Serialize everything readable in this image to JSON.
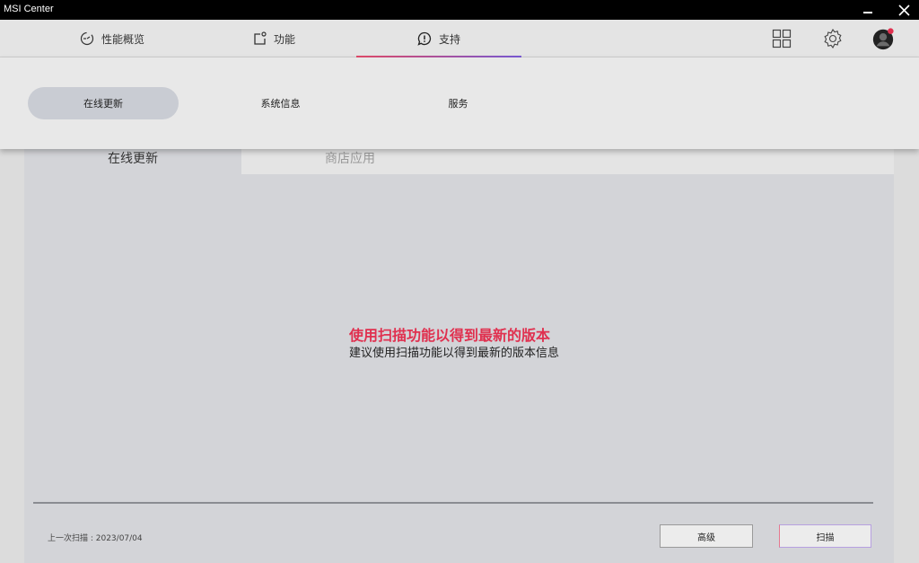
{
  "window": {
    "title": "MSI Center",
    "minimize_label": "–",
    "close_label": "X"
  },
  "topnav": {
    "tabs": [
      {
        "label": "性能概览",
        "icon": "gauge-icon"
      },
      {
        "label": "功能",
        "icon": "feature-icon"
      },
      {
        "label": "支持",
        "icon": "chat-alert-icon",
        "active": true
      }
    ],
    "icons": [
      "grid-icon",
      "gear-icon",
      "avatar-icon"
    ],
    "accent_gradient": [
      "#e34b6a",
      "#7a5bd6"
    ]
  },
  "subnav": {
    "items": [
      {
        "label": "在线更新",
        "active": true
      },
      {
        "label": "系统信息"
      },
      {
        "label": "服务"
      }
    ]
  },
  "content": {
    "tabs": [
      {
        "label": "在线更新",
        "active": true
      },
      {
        "label": "商店应用"
      }
    ],
    "message_title": "使用扫描功能以得到最新的版本",
    "message_subtitle": "建议使用扫描功能以得到最新的版本信息",
    "message_title_color": "#e0304f",
    "last_scan": "上一次扫描 : 2023/07/04",
    "buttons": {
      "advanced": "高级",
      "scan": "扫描"
    }
  }
}
